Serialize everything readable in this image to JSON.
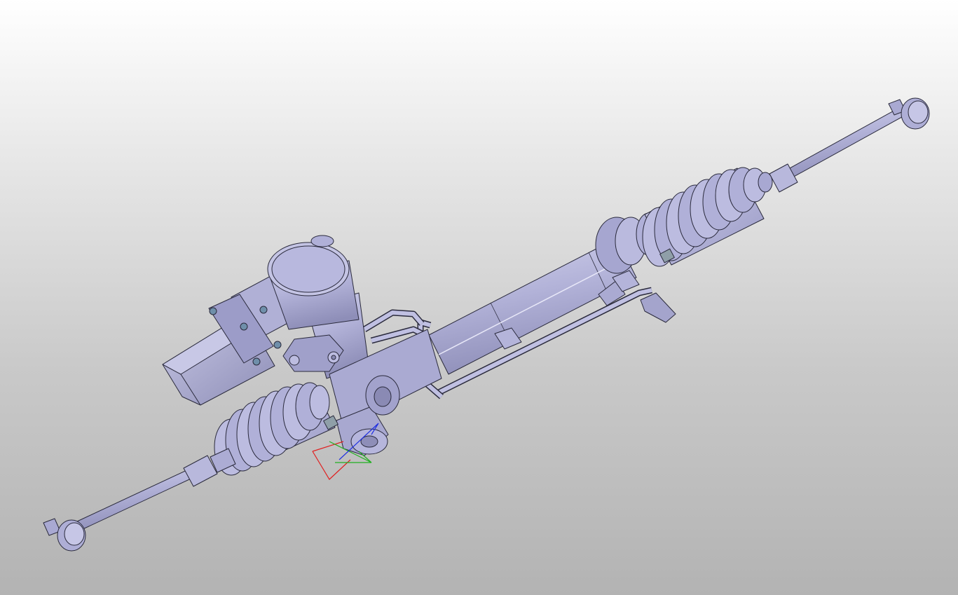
{
  "viewport": {
    "background_top": "#ffffff",
    "background_bottom": "#b3b3b3",
    "model_color": "#b6b6dc",
    "edge_color": "#2a2a3c"
  },
  "model": {
    "icon": "steering-rack-assembly-icon"
  },
  "triad": {
    "x_color": "#e02020",
    "y_color": "#20b020",
    "z_color": "#2030e0"
  }
}
